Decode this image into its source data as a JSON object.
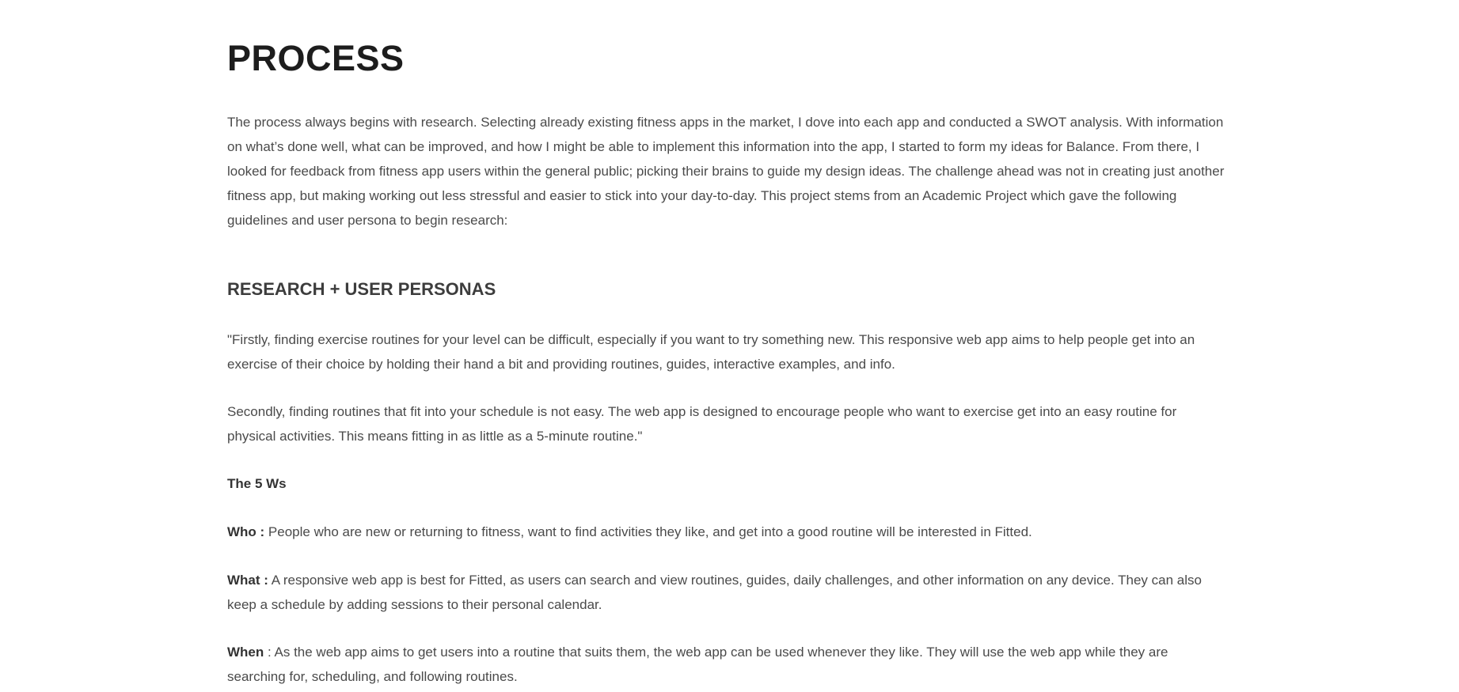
{
  "process": {
    "title": "PROCESS",
    "intro": "The process always begins with research. Selecting already existing fitness apps in the market, I dove into each app and conducted a SWOT analysis. With information on what’s done well, what can be improved, and how I might be able to implement this information into the app, I started to form my ideas for Balance. From there, I looked for feedback from fitness app users within the general public; picking their brains to guide my design ideas. The challenge ahead was not in creating just another fitness app, but making working out less stressful and easier to stick into your day-to-day. This project stems from an Academic Project which gave the following guidelines and user persona to begin research:"
  },
  "research": {
    "heading": "RESEARCH + USER PERSONAS",
    "quote_part1": "\"Firstly, finding exercise routines for your level can be difficult, especially if you want to try something new. This responsive web app aims to help people get into an exercise of their choice by holding their hand a bit and providing routines, guides, interactive examples, and info.",
    "quote_part2": "Secondly, finding routines that fit into your schedule is not easy. The web app is designed to encourage people who want to exercise get into an easy routine for physical activities. This means fitting in as little as a 5-minute routine.\"",
    "five_ws_heading": "The 5 Ws",
    "who": {
      "label": "Who :",
      "text": " People who are new or returning to fitness, want to find activities they like, and get into a good routine will be interested in Fitted."
    },
    "what": {
      "label": "What :",
      "text": " A responsive web app is best for Fitted, as users can search and view routines, guides, daily challenges, and other information on any device. They can also keep a schedule by adding sessions to their personal calendar."
    },
    "when": {
      "label": "When",
      "text": " : As the web app aims to get users into a routine that suits them, the web app can be used whenever they like. They will use the web app while they are searching for, scheduling, and following routines."
    }
  }
}
